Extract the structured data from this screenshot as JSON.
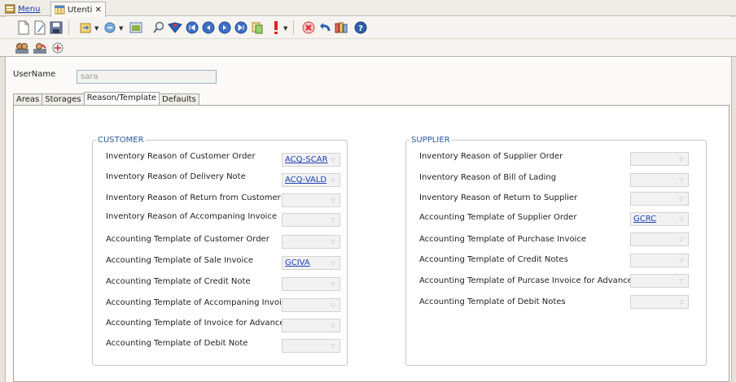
{
  "tabs": [
    {
      "label": "Menu"
    },
    {
      "label": "Utenti",
      "close": "✕"
    }
  ],
  "form": {
    "username_label": "UserName",
    "username_value": "sara"
  },
  "inner_tabs": [
    "Areas",
    "Storages",
    "Reason/Template",
    "Defaults"
  ],
  "customer": {
    "title": "CUSTOMER",
    "rows": [
      {
        "label": "Inventory Reason of Customer Order",
        "value": "ACQ-SCAR"
      },
      {
        "label": "Inventory Reason of Delivery Note",
        "value": "ACQ-VALD"
      },
      {
        "label": "Inventory Reason of Return from Customer",
        "value": ""
      },
      {
        "label": "Inventory Reason of Accompaning Invoice",
        "value": ""
      },
      {
        "label": "Accounting Template of Customer Order",
        "value": ""
      },
      {
        "label": "Accounting Template of Sale Invoice",
        "value": "GCIVA"
      },
      {
        "label": "Accounting Template of Credit Note",
        "value": ""
      },
      {
        "label": "Accounting Template of Accompaning Invoice",
        "value": ""
      },
      {
        "label": "Accounting Template of Invoice for Advance",
        "value": ""
      },
      {
        "label": "Accounting Template of Debit Note",
        "value": ""
      }
    ]
  },
  "supplier": {
    "title": "SUPPLIER",
    "rows": [
      {
        "label": "Inventory Reason of Supplier Order",
        "value": ""
      },
      {
        "label": "Inventory Reason of Bill of Lading",
        "value": ""
      },
      {
        "label": "Inventory Reason of Return to Supplier",
        "value": ""
      },
      {
        "label": "Accounting Template of Supplier Order",
        "value": "GCRC"
      },
      {
        "label": "Accounting Template of Purchase Invoice",
        "value": ""
      },
      {
        "label": "Accounting Template of Credit Notes",
        "value": ""
      },
      {
        "label": "Accounting Template of Purcase Invoice for Advance",
        "value": ""
      },
      {
        "label": "Accounting Template of Debit Notes",
        "value": ""
      }
    ]
  },
  "toolbar_icons": [
    "new-doc-icon",
    "edit-doc-icon",
    "save-icon",
    "import-icon",
    "dropdown-arrow",
    "export-icon",
    "dropdown-arrow",
    "table-icon",
    "search-icon",
    "filter-icon",
    "first-record-icon",
    "previous-record-icon",
    "next-record-icon",
    "last-record-icon",
    "copy-icon",
    "exclamation-icon",
    "dropdown-arrow",
    "delete-icon",
    "undo-icon",
    "columns-icon",
    "help-icon"
  ],
  "toolbar2_icons": [
    "users-icon",
    "user-edit-icon",
    "settings-icon"
  ],
  "colors": {
    "link": "#1a3fb4",
    "group_title": "#2a5a9c",
    "toolbar_bg": "#f6f4f0"
  }
}
